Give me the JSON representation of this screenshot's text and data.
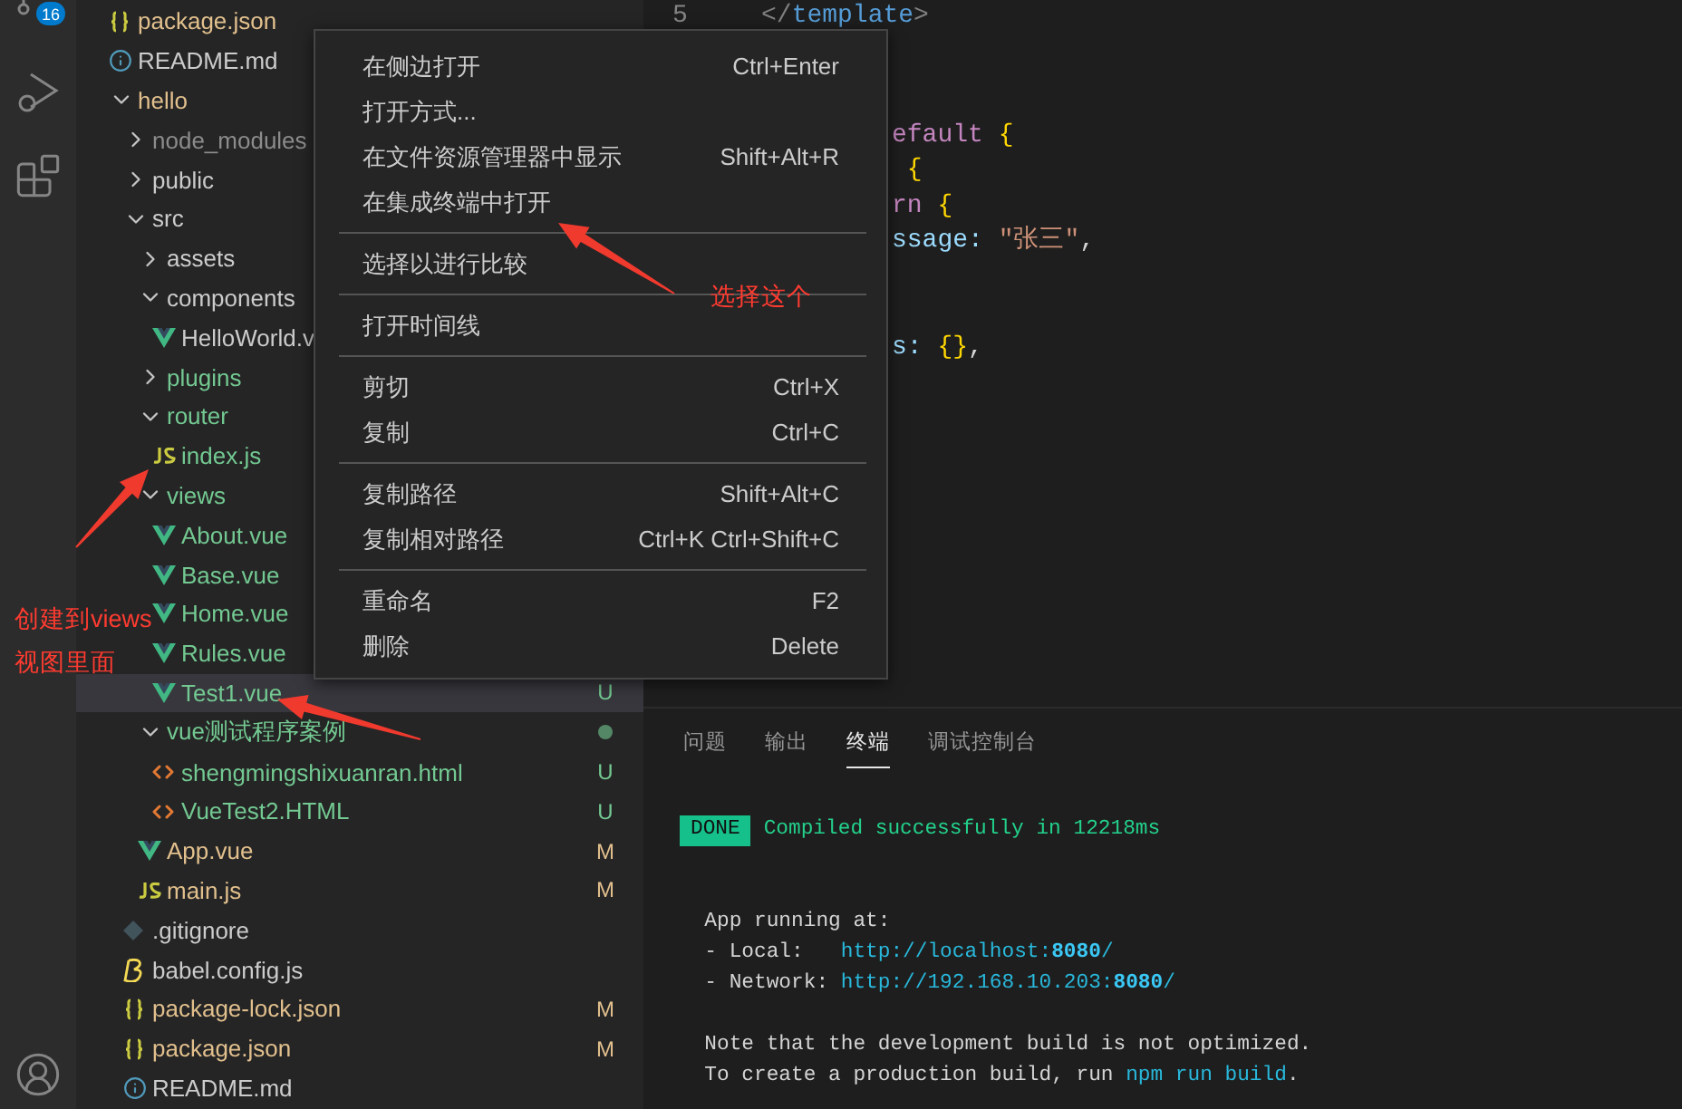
{
  "activity_bar": {
    "items": [
      {
        "kind": "source-control",
        "badge": "16"
      },
      {
        "kind": "debug"
      },
      {
        "kind": "extensions"
      },
      {
        "kind": "account"
      }
    ]
  },
  "explorer": {
    "items": [
      {
        "name": "package.json",
        "kind": "json",
        "color": "#e2c08d",
        "selected": false
      },
      {
        "name": "README.md",
        "kind": "info",
        "color": "#cccccc",
        "selected": false
      },
      {
        "name": "hello",
        "kind": "folder",
        "color": "#e2c08d",
        "expanded": true,
        "selected": false,
        "children": [
          {
            "name": "node_modules",
            "kind": "folder",
            "color": "#8c8c8c",
            "expanded": false,
            "selected": false
          },
          {
            "name": "public",
            "kind": "folder",
            "color": "#cccccc",
            "expanded": false,
            "selected": false
          },
          {
            "name": "src",
            "kind": "folder",
            "color": "#cccccc",
            "expanded": true,
            "selected": false,
            "children": [
              {
                "name": "assets",
                "kind": "folder",
                "color": "#cccccc",
                "expanded": false,
                "selected": false
              },
              {
                "name": "components",
                "kind": "folder",
                "color": "#cccccc",
                "expanded": true,
                "selected": false,
                "children": [
                  {
                    "name": "HelloWorld.v",
                    "kind": "vue",
                    "color": "#cccccc",
                    "selected": false
                  }
                ]
              },
              {
                "name": "plugins",
                "kind": "folder",
                "color": "#73c991",
                "expanded": false,
                "selected": false
              },
              {
                "name": "router",
                "kind": "folder",
                "color": "#73c991",
                "expanded": true,
                "selected": false,
                "children": [
                  {
                    "name": "index.js",
                    "kind": "js",
                    "color": "#73c991",
                    "selected": false
                  }
                ]
              },
              {
                "name": "views",
                "kind": "folder",
                "color": "#73c991",
                "expanded": true,
                "selected": false,
                "children": [
                  {
                    "name": "About.vue",
                    "kind": "vue",
                    "color": "#73c991",
                    "selected": false
                  },
                  {
                    "name": "Base.vue",
                    "kind": "vue",
                    "color": "#73c991",
                    "selected": false
                  },
                  {
                    "name": "Home.vue",
                    "kind": "vue",
                    "color": "#73c991",
                    "selected": false
                  },
                  {
                    "name": "Rules.vue",
                    "kind": "vue",
                    "color": "#73c991",
                    "selected": false
                  },
                  {
                    "name": "Test1.vue",
                    "kind": "vue",
                    "color": "#73c991",
                    "badge": "U",
                    "selected": true
                  }
                ]
              },
              {
                "name": "vue测试程序案例",
                "kind": "folder",
                "color": "#73c991",
                "expanded": true,
                "dot": true,
                "selected": false,
                "children": [
                  {
                    "name": "shengmingshixuanran.html",
                    "kind": "html",
                    "color": "#73c991",
                    "badge": "U",
                    "selected": false
                  },
                  {
                    "name": "VueTest2.HTML",
                    "kind": "html",
                    "color": "#73c991",
                    "badge": "U",
                    "selected": false
                  }
                ]
              },
              {
                "name": "App.vue",
                "kind": "vue",
                "color": "#e2c08d",
                "badge": "M",
                "selected": false
              },
              {
                "name": "main.js",
                "kind": "js",
                "color": "#e2c08d",
                "badge": "M",
                "selected": false
              }
            ]
          },
          {
            "name": ".gitignore",
            "kind": "git",
            "color": "#cccccc",
            "selected": false
          },
          {
            "name": "babel.config.js",
            "kind": "babel",
            "color": "#cccccc",
            "selected": false
          },
          {
            "name": "package-lock.json",
            "kind": "json",
            "color": "#e2c08d",
            "badge": "M",
            "selected": false
          },
          {
            "name": "package.json",
            "kind": "json",
            "color": "#e2c08d",
            "badge": "M",
            "selected": false
          },
          {
            "name": "README.md",
            "kind": "info",
            "color": "#cccccc",
            "selected": false
          }
        ]
      }
    ]
  },
  "editor": {
    "top_line": {
      "number": "5",
      "tokens": [
        {
          "text": "</",
          "kind": "bracket"
        },
        {
          "text": "template",
          "kind": "tag"
        },
        {
          "text": ">",
          "kind": "bracket"
        }
      ]
    },
    "lines": [
      {
        "kind": "code",
        "tokens": [
          {
            "text": "efault",
            "kind": "keyword"
          },
          {
            "text": " {",
            "kind": "brace"
          }
        ]
      },
      {
        "kind": "code",
        "tokens": [
          {
            "text": " {",
            "kind": "brace"
          }
        ]
      },
      {
        "kind": "code",
        "tokens": [
          {
            "text": "rn",
            "kind": "keyword"
          },
          {
            "text": " {",
            "kind": "brace"
          }
        ]
      },
      {
        "kind": "code",
        "tokens": [
          {
            "text": "ssage:",
            "kind": "prop"
          },
          {
            "text": " \"张三\"",
            "kind": "string"
          },
          {
            "text": ",",
            "kind": "plain"
          }
        ]
      },
      {
        "kind": "blank"
      },
      {
        "kind": "blank"
      },
      {
        "kind": "code",
        "tokens": [
          {
            "text": "s:",
            "kind": "prop"
          },
          {
            "text": " {}",
            "kind": "brace"
          },
          {
            "text": ",",
            "kind": "plain"
          }
        ]
      }
    ]
  },
  "context_menu": {
    "groups": [
      {
        "items": [
          {
            "label": "在侧边打开",
            "shortcut": "Ctrl+Enter"
          },
          {
            "label": "打开方式..."
          },
          {
            "label": "在文件资源管理器中显示",
            "shortcut": "Shift+Alt+R"
          },
          {
            "label": "在集成终端中打开"
          }
        ]
      },
      {
        "items": [
          {
            "label": "选择以进行比较"
          }
        ]
      },
      {
        "items": [
          {
            "label": "打开时间线"
          }
        ]
      },
      {
        "items": [
          {
            "label": "剪切",
            "shortcut": "Ctrl+X"
          },
          {
            "label": "复制",
            "shortcut": "Ctrl+C"
          }
        ]
      },
      {
        "items": [
          {
            "label": "复制路径",
            "shortcut": "Shift+Alt+C"
          },
          {
            "label": "复制相对路径",
            "shortcut": "Ctrl+K Ctrl+Shift+C"
          }
        ]
      },
      {
        "items": [
          {
            "label": "重命名",
            "shortcut": "F2"
          },
          {
            "label": "删除",
            "shortcut": "Delete"
          }
        ]
      }
    ]
  },
  "panel": {
    "tabs": [
      {
        "label": "问题",
        "selected": false
      },
      {
        "label": "输出",
        "selected": false
      },
      {
        "label": "终端",
        "selected": true
      },
      {
        "label": "调试控制台",
        "selected": false
      }
    ],
    "terminal": {
      "status_badge": "DONE",
      "status_text": "Compiled successfully in 12218ms",
      "lines": [
        {
          "kind": "blank"
        },
        {
          "kind": "blank"
        },
        {
          "kind": "text",
          "tokens": [
            {
              "text": "  App running at:",
              "kind": "plain"
            }
          ]
        },
        {
          "kind": "text",
          "tokens": [
            {
              "text": "  - Local:   ",
              "kind": "plain"
            },
            {
              "text": "http://localhost:",
              "kind": "link"
            },
            {
              "text": "8080",
              "kind": "link-strong"
            },
            {
              "text": "/",
              "kind": "link"
            }
          ]
        },
        {
          "kind": "text",
          "tokens": [
            {
              "text": "  - Network: ",
              "kind": "plain"
            },
            {
              "text": "http://192.168.10.203:",
              "kind": "link"
            },
            {
              "text": "8080",
              "kind": "link-strong"
            },
            {
              "text": "/",
              "kind": "link"
            }
          ]
        },
        {
          "kind": "blank"
        },
        {
          "kind": "text",
          "tokens": [
            {
              "text": "  Note that the development build is not optimized.",
              "kind": "plain"
            }
          ]
        },
        {
          "kind": "text",
          "tokens": [
            {
              "text": "  To create a production build, run ",
              "kind": "plain"
            },
            {
              "text": "npm run build",
              "kind": "link"
            },
            {
              "text": ".",
              "kind": "plain"
            }
          ]
        }
      ]
    }
  },
  "annotations": [
    {
      "kind": "label",
      "lines": [
        "选择这个"
      ]
    },
    {
      "kind": "label",
      "lines": [
        "创建到views",
        "视图里面"
      ]
    }
  ]
}
